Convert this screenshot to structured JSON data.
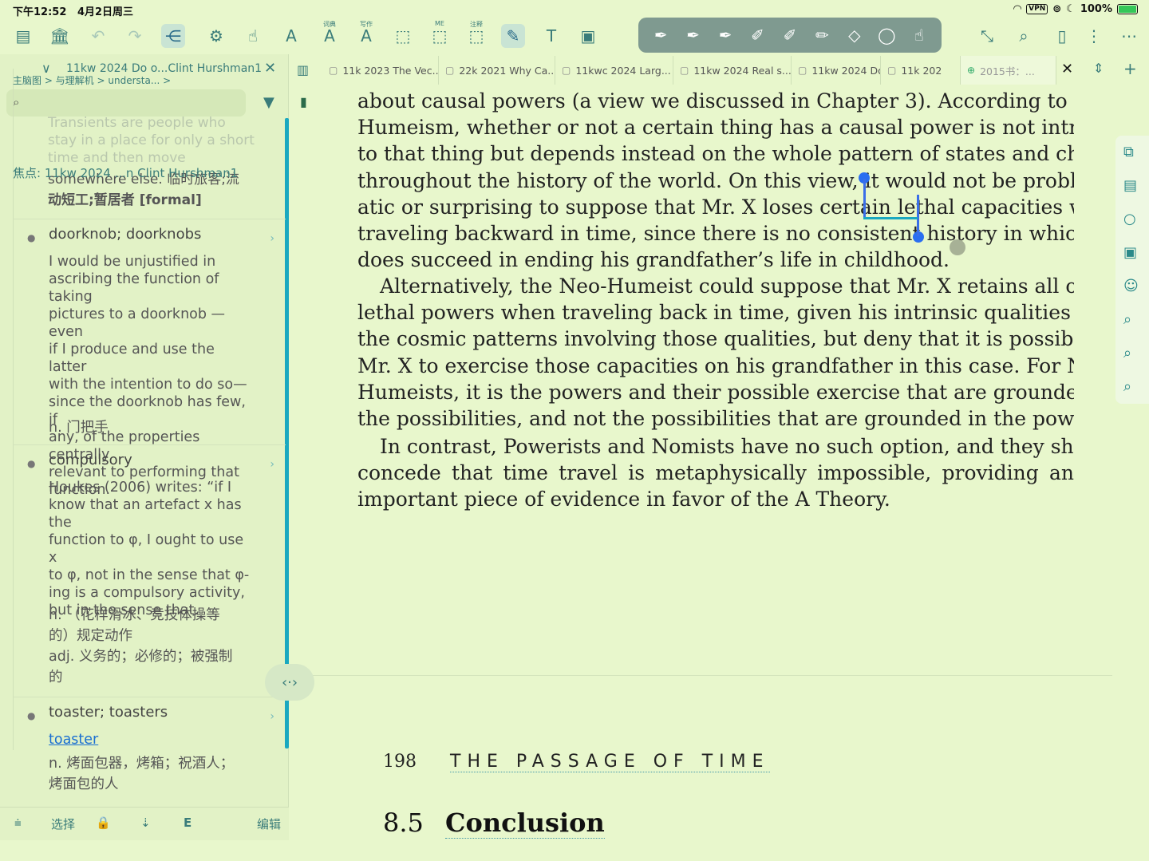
{
  "status": {
    "time": "下午12:52",
    "date": "4月2日周三",
    "vpn": "VPN",
    "battery": "100%"
  },
  "toolbar": {
    "dict_caption": "词典",
    "write_caption": "写作",
    "me_caption": "ME",
    "note_caption": "注释"
  },
  "left_panel": {
    "title": "11kw 2024 Do o...Clint Hurshman1",
    "search_placeholder": "",
    "breadcrumb": "主脑图 >    与理解机    >    understa...  >",
    "focus": "焦点:  11kw 2024 ...n Clint Hurshman1",
    "ghost_lines": [
      "Transients are people who",
      "stay in a place for only a short",
      "time and then move",
      "somewhere else. 临时旅客;流"
    ],
    "top_entry_zh": "动短工;暂居者 [formal]",
    "entries": [
      {
        "word": "doorknob; doorknobs",
        "body_lines": [
          "I would be unjustified in",
          "ascribing the function of taking",
          "pictures to a doorknob —even",
          "if I produce and use the latter",
          "with the intention to do so—",
          "since the doorknob has few, if",
          "any, of the properties centrally",
          "relevant to performing that",
          "function."
        ],
        "zh": "n. 门把手"
      },
      {
        "word": "compulsory",
        "body_lines": [
          "Houkes (2006) writes: “if I",
          "know that an artefact x has the",
          "function to φ, I ought to use x",
          "to φ, not in the sense that φ-",
          "ing is a compulsory activity,",
          "but in the sense that."
        ],
        "zh_lines": [
          "n. （花样滑冰、竞技体操等",
          "的）规定动作",
          "adj. 义务的；必修的；被强制",
          "的"
        ]
      },
      {
        "word": "toaster; toasters",
        "link": "toaster",
        "zh_lines": [
          "n. 烤面包器，烤箱；祝酒人；",
          "烤面包的人"
        ]
      }
    ],
    "bottom": {
      "select": "选择",
      "edit": "编辑",
      "e_label": "E"
    }
  },
  "tabs": [
    "11k 2023 The Vec...",
    "22k 2021 Why Ca...",
    "11kwc 2024 Larg...",
    "11kw 2024 Real s...",
    "11kw 2024 Do",
    "11k 202",
    "2015书：..."
  ],
  "document": {
    "para1": [
      "about causal powers (a view we discussed in Chapter 3). According to Neo-",
      "Humeism, whether or not a certain thing has a causal power is not intrinsic",
      "to that thing but depends instead on the whole pattern of states and changes",
      "throughout the history of the world. On this view, it would not be problem-",
      "atic or surprising to suppose that Mr. X loses certain lethal capacities when",
      "traveling backward in time, since there is no consistent history in which he",
      "does succeed in ending his grandfather’s life in childhood."
    ],
    "para2": [
      "Alternatively, the Neo-Humeist could suppose that Mr. X retains all of his",
      "lethal powers when traveling back in time, given his intrinsic qualities and",
      "the cosmic patterns involving those qualities, but deny that it is possible for",
      "Mr. X to exercise those capacities on his grandfather in this case. For Neo-",
      "Humeists, it is the powers and their possible exercise that are grounded in",
      "the possibilities, and not the possibilities that are grounded in the powers."
    ],
    "para3": [
      "In contrast, Powerists and Nomists have no such option, and they should",
      "concede that time travel is metaphysically impossible, providing an",
      "important piece of evidence in favor of the A Theory."
    ],
    "page_number": "198",
    "running_head": "THE PASSAGE OF TIME",
    "section_number": "8.5",
    "section_title": "Conclusion"
  }
}
